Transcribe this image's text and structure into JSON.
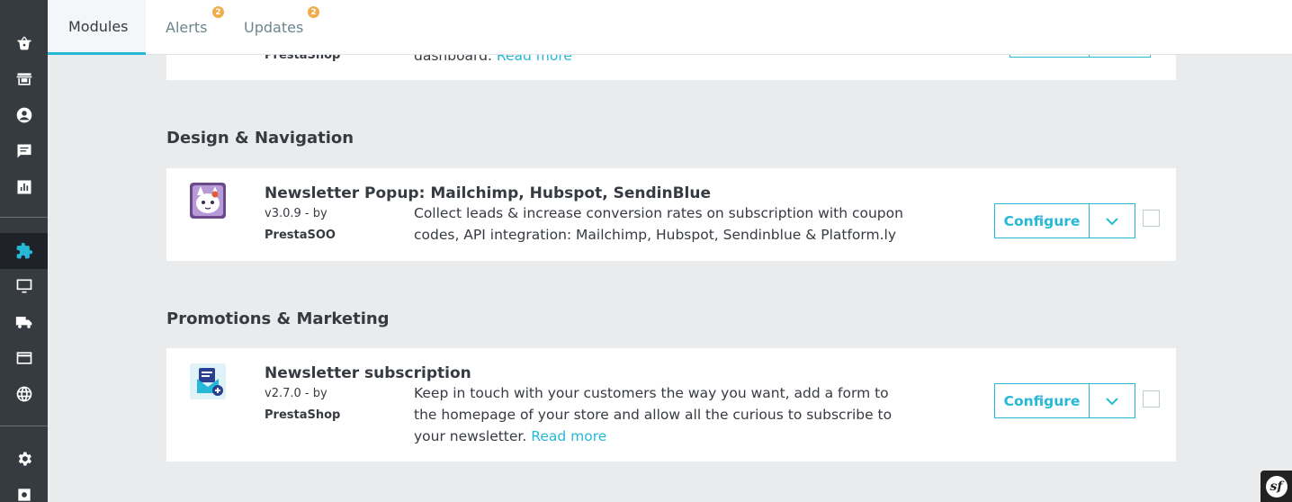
{
  "tabs": [
    {
      "label": "Modules",
      "badge": ""
    },
    {
      "label": "Alerts",
      "badge": "2"
    },
    {
      "label": "Updates",
      "badge": "2"
    }
  ],
  "top_card": {
    "author": "PrestaShop",
    "desc_text": "dashboard.",
    "read_more": "Read more"
  },
  "sections": [
    {
      "title": "Design & Navigation",
      "module": {
        "name": "Newsletter Popup: Mailchimp, Hubspot, SendinBlue",
        "version": "v3.0.9 - by",
        "author": "PrestaSOO",
        "description": "Collect leads & increase conversion rates on subscription with coupon codes, API integration: Mailchimp, Hubspot, Sendinblue & Platform.ly",
        "configure_label": "Configure"
      }
    },
    {
      "title": "Promotions & Marketing",
      "module": {
        "name": "Newsletter subscription",
        "version": "v2.7.0 - by",
        "author": "PrestaShop",
        "description": "Keep in touch with your customers the way you want, add a form to the homepage of your store and allow all the curious to subscribe to your newsletter.",
        "read_more": "Read more",
        "configure_label": "Configure"
      }
    }
  ],
  "sidebar_icons": [
    "basket-icon",
    "store-icon",
    "user-icon",
    "chat-icon",
    "stats-icon",
    "puzzle-icon",
    "monitor-icon",
    "truck-icon",
    "credit-card-icon",
    "globe-icon",
    "gear-icon",
    "gear-icon"
  ],
  "colors": {
    "accent": "#25b9d7",
    "sidebar": "#363a41",
    "badge": "#f0ad4e"
  },
  "symfony_glyph": "sf"
}
